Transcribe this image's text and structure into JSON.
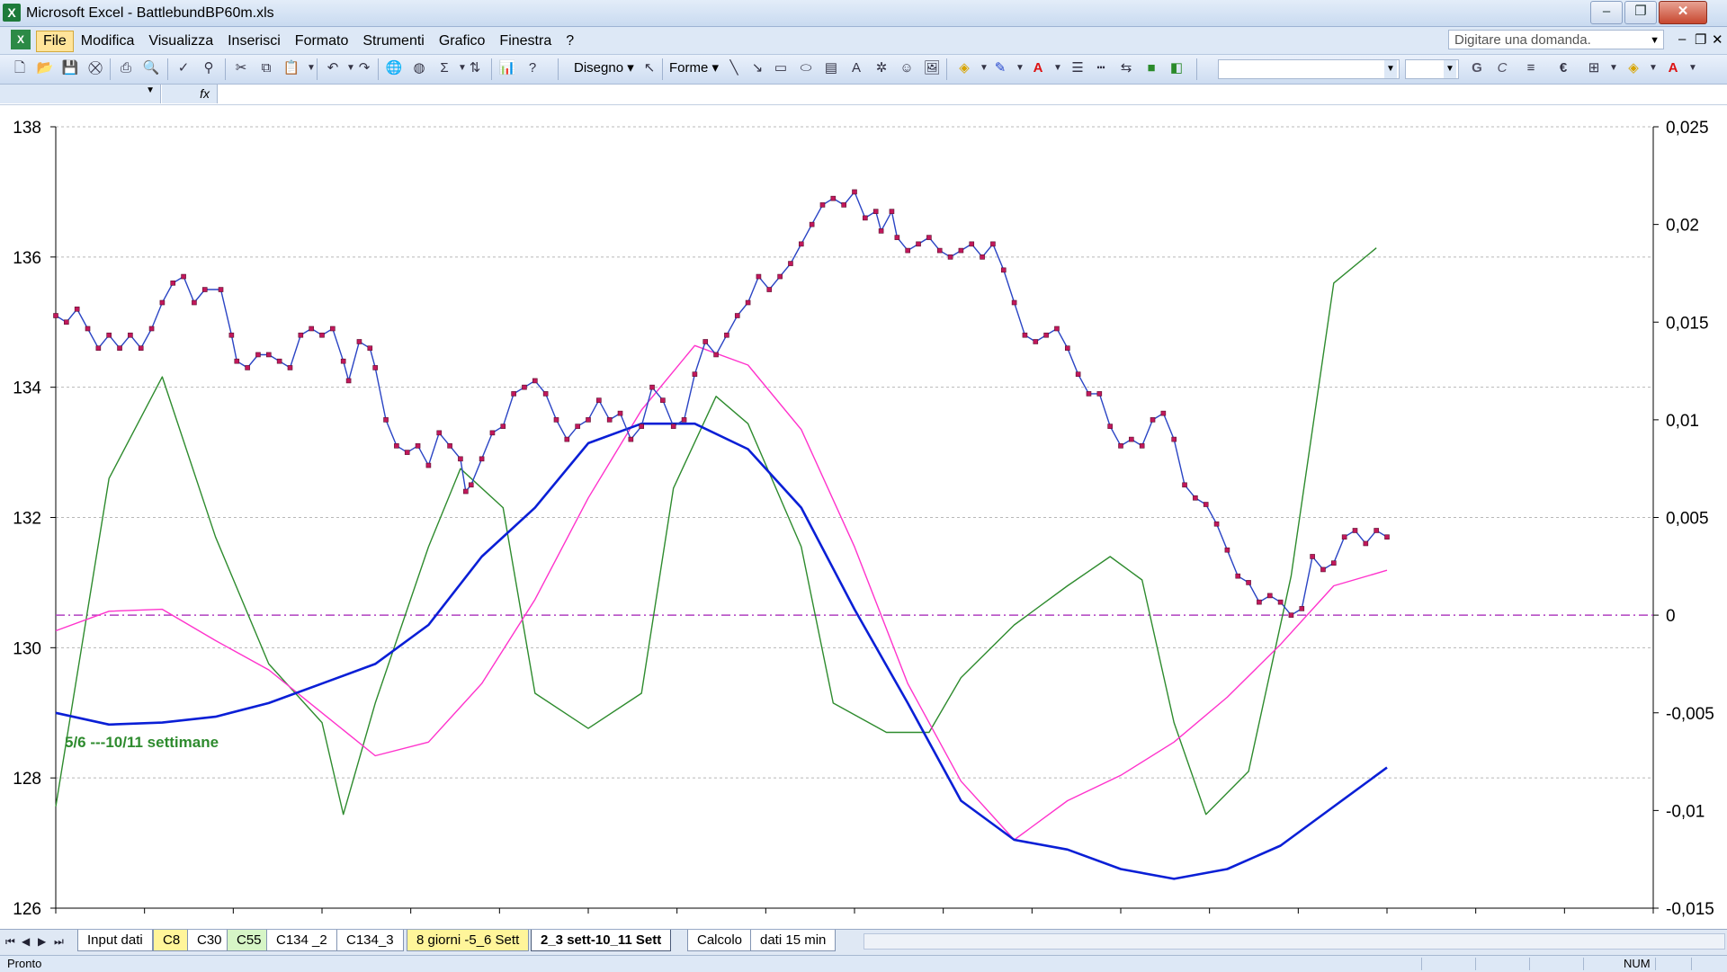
{
  "window": {
    "title": "Microsoft Excel - BattlebundBP60m.xls",
    "app_icon": "X"
  },
  "menu": {
    "doc_icon": "X",
    "items": [
      "File",
      "Modifica",
      "Visualizza",
      "Inserisci",
      "Formato",
      "Strumenti",
      "Grafico",
      "Finestra",
      "?"
    ],
    "active": "File",
    "ask_placeholder": "Digitare una domanda."
  },
  "toolbar": {
    "draw_label": "Disegno",
    "shapes_label": "Forme",
    "bold": "G",
    "italic": "C",
    "euro": "€"
  },
  "formula": {
    "fx": "fx"
  },
  "chart_data": {
    "type": "line",
    "title": "",
    "annotation": "5/6 ---10/11 settimane",
    "y_left": {
      "min": 126,
      "max": 138,
      "ticks": [
        "138",
        "136",
        "134",
        "132",
        "130",
        "128",
        "126"
      ]
    },
    "y_right": {
      "min": -0.015,
      "max": 0.025,
      "ticks": [
        "0,025",
        "0,02",
        "0,015",
        "0,01",
        "0,005",
        "0",
        "-0,005",
        "-0,01",
        "-0,015"
      ]
    },
    "grid": "horizontal-dashed",
    "zero_line_right": 0,
    "colors": {
      "price": "#2a44c4",
      "marker": "#c2185b",
      "blue": "#0a1fd6",
      "magenta": "#ff33cc",
      "green": "#2e8b2e",
      "zero": "#b040c0"
    },
    "series": [
      {
        "axis": "left",
        "style": "markers",
        "points": [
          [
            0,
            135.1
          ],
          [
            0.01,
            135.0
          ],
          [
            0.02,
            135.2
          ],
          [
            0.03,
            134.9
          ],
          [
            0.04,
            134.6
          ],
          [
            0.05,
            134.8
          ],
          [
            0.06,
            134.6
          ],
          [
            0.07,
            134.8
          ],
          [
            0.08,
            134.6
          ],
          [
            0.09,
            134.9
          ],
          [
            0.1,
            135.3
          ],
          [
            0.11,
            135.6
          ],
          [
            0.12,
            135.7
          ],
          [
            0.13,
            135.3
          ],
          [
            0.14,
            135.5
          ],
          [
            0.155,
            135.5
          ],
          [
            0.165,
            134.8
          ],
          [
            0.17,
            134.4
          ],
          [
            0.18,
            134.3
          ],
          [
            0.19,
            134.5
          ],
          [
            0.2,
            134.5
          ],
          [
            0.21,
            134.4
          ],
          [
            0.22,
            134.3
          ],
          [
            0.23,
            134.8
          ],
          [
            0.24,
            134.9
          ],
          [
            0.25,
            134.8
          ],
          [
            0.26,
            134.9
          ],
          [
            0.27,
            134.4
          ],
          [
            0.275,
            134.1
          ],
          [
            0.285,
            134.7
          ],
          [
            0.295,
            134.6
          ],
          [
            0.3,
            134.3
          ],
          [
            0.31,
            133.5
          ],
          [
            0.32,
            133.1
          ],
          [
            0.33,
            133.0
          ],
          [
            0.34,
            133.1
          ],
          [
            0.35,
            132.8
          ],
          [
            0.36,
            133.3
          ],
          [
            0.37,
            133.1
          ],
          [
            0.38,
            132.9
          ],
          [
            0.385,
            132.4
          ],
          [
            0.39,
            132.5
          ],
          [
            0.4,
            132.9
          ],
          [
            0.41,
            133.3
          ],
          [
            0.42,
            133.4
          ],
          [
            0.43,
            133.9
          ],
          [
            0.44,
            134.0
          ],
          [
            0.45,
            134.1
          ],
          [
            0.46,
            133.9
          ],
          [
            0.47,
            133.5
          ],
          [
            0.48,
            133.2
          ],
          [
            0.49,
            133.4
          ],
          [
            0.5,
            133.5
          ],
          [
            0.51,
            133.8
          ],
          [
            0.52,
            133.5
          ],
          [
            0.53,
            133.6
          ],
          [
            0.54,
            133.2
          ],
          [
            0.55,
            133.4
          ],
          [
            0.56,
            134.0
          ],
          [
            0.57,
            133.8
          ],
          [
            0.58,
            133.4
          ],
          [
            0.59,
            133.5
          ],
          [
            0.6,
            134.2
          ],
          [
            0.61,
            134.7
          ],
          [
            0.62,
            134.5
          ],
          [
            0.63,
            134.8
          ],
          [
            0.64,
            135.1
          ],
          [
            0.65,
            135.3
          ],
          [
            0.66,
            135.7
          ],
          [
            0.67,
            135.5
          ],
          [
            0.68,
            135.7
          ],
          [
            0.69,
            135.9
          ],
          [
            0.7,
            136.2
          ],
          [
            0.71,
            136.5
          ],
          [
            0.72,
            136.8
          ],
          [
            0.73,
            136.9
          ],
          [
            0.74,
            136.8
          ],
          [
            0.75,
            137.0
          ],
          [
            0.76,
            136.6
          ],
          [
            0.77,
            136.7
          ],
          [
            0.775,
            136.4
          ],
          [
            0.785,
            136.7
          ],
          [
            0.79,
            136.3
          ],
          [
            0.8,
            136.1
          ],
          [
            0.81,
            136.2
          ],
          [
            0.82,
            136.3
          ],
          [
            0.83,
            136.1
          ],
          [
            0.84,
            136.0
          ],
          [
            0.85,
            136.1
          ],
          [
            0.86,
            136.2
          ],
          [
            0.87,
            136.0
          ],
          [
            0.88,
            136.2
          ],
          [
            0.89,
            135.8
          ],
          [
            0.9,
            135.3
          ],
          [
            0.91,
            134.8
          ],
          [
            0.92,
            134.7
          ],
          [
            0.93,
            134.8
          ],
          [
            0.94,
            134.9
          ],
          [
            0.95,
            134.6
          ],
          [
            0.96,
            134.2
          ],
          [
            0.97,
            133.9
          ],
          [
            0.98,
            133.9
          ],
          [
            0.99,
            133.4
          ],
          [
            1.0,
            133.1
          ],
          [
            1.01,
            133.2
          ],
          [
            1.02,
            133.1
          ],
          [
            1.03,
            133.5
          ],
          [
            1.04,
            133.6
          ],
          [
            1.05,
            133.2
          ],
          [
            1.06,
            132.5
          ],
          [
            1.07,
            132.3
          ],
          [
            1.08,
            132.2
          ],
          [
            1.09,
            131.9
          ],
          [
            1.1,
            131.5
          ],
          [
            1.11,
            131.1
          ],
          [
            1.12,
            131.0
          ],
          [
            1.13,
            130.7
          ],
          [
            1.14,
            130.8
          ],
          [
            1.15,
            130.7
          ],
          [
            1.16,
            130.5
          ],
          [
            1.17,
            130.6
          ],
          [
            1.18,
            131.4
          ],
          [
            1.19,
            131.2
          ],
          [
            1.2,
            131.3
          ],
          [
            1.21,
            131.7
          ],
          [
            1.22,
            131.8
          ],
          [
            1.23,
            131.6
          ],
          [
            1.24,
            131.8
          ],
          [
            1.25,
            131.7
          ]
        ]
      },
      {
        "axis": "right",
        "style": "line",
        "color": "blue",
        "points": [
          [
            0,
            -0.005
          ],
          [
            0.05,
            -0.0056
          ],
          [
            0.1,
            -0.0055
          ],
          [
            0.15,
            -0.0052
          ],
          [
            0.2,
            -0.0045
          ],
          [
            0.25,
            -0.0035
          ],
          [
            0.3,
            -0.0025
          ],
          [
            0.35,
            -0.0005
          ],
          [
            0.4,
            0.003
          ],
          [
            0.45,
            0.0055
          ],
          [
            0.5,
            0.0088
          ],
          [
            0.55,
            0.0098
          ],
          [
            0.6,
            0.0098
          ],
          [
            0.65,
            0.0085
          ],
          [
            0.7,
            0.0055
          ],
          [
            0.75,
            0.0003
          ],
          [
            0.8,
            -0.0045
          ],
          [
            0.85,
            -0.0095
          ],
          [
            0.9,
            -0.0115
          ],
          [
            0.95,
            -0.012
          ],
          [
            1.0,
            -0.013
          ],
          [
            1.05,
            -0.0135
          ],
          [
            1.1,
            -0.013
          ],
          [
            1.15,
            -0.0118
          ],
          [
            1.2,
            -0.0098
          ],
          [
            1.25,
            -0.0078
          ]
        ]
      },
      {
        "axis": "right",
        "style": "line",
        "color": "magenta",
        "points": [
          [
            0,
            -0.0008
          ],
          [
            0.05,
            0.0002
          ],
          [
            0.1,
            0.0003
          ],
          [
            0.15,
            -0.0013
          ],
          [
            0.2,
            -0.0028
          ],
          [
            0.25,
            -0.005
          ],
          [
            0.3,
            -0.0072
          ],
          [
            0.35,
            -0.0065
          ],
          [
            0.4,
            -0.0035
          ],
          [
            0.45,
            0.0008
          ],
          [
            0.5,
            0.006
          ],
          [
            0.55,
            0.0105
          ],
          [
            0.6,
            0.0138
          ],
          [
            0.65,
            0.0128
          ],
          [
            0.7,
            0.0095
          ],
          [
            0.75,
            0.0035
          ],
          [
            0.8,
            -0.0035
          ],
          [
            0.85,
            -0.0085
          ],
          [
            0.9,
            -0.0115
          ],
          [
            0.95,
            -0.0095
          ],
          [
            1.0,
            -0.0082
          ],
          [
            1.05,
            -0.0065
          ],
          [
            1.1,
            -0.0042
          ],
          [
            1.15,
            -0.0015
          ],
          [
            1.2,
            0.0015
          ],
          [
            1.25,
            0.0023
          ]
        ]
      },
      {
        "axis": "right",
        "style": "line",
        "color": "green",
        "points": [
          [
            0,
            -0.0098
          ],
          [
            0.05,
            0.007
          ],
          [
            0.1,
            0.0122
          ],
          [
            0.15,
            0.004
          ],
          [
            0.2,
            -0.0025
          ],
          [
            0.25,
            -0.0055
          ],
          [
            0.27,
            -0.0102
          ],
          [
            0.3,
            -0.0045
          ],
          [
            0.35,
            0.0035
          ],
          [
            0.38,
            0.0075
          ],
          [
            0.42,
            0.0055
          ],
          [
            0.45,
            -0.004
          ],
          [
            0.5,
            -0.0058
          ],
          [
            0.55,
            -0.004
          ],
          [
            0.58,
            0.0065
          ],
          [
            0.62,
            0.0112
          ],
          [
            0.65,
            0.0098
          ],
          [
            0.7,
            0.0035
          ],
          [
            0.73,
            -0.0045
          ],
          [
            0.78,
            -0.006
          ],
          [
            0.82,
            -0.006
          ],
          [
            0.85,
            -0.0032
          ],
          [
            0.9,
            -0.0005
          ],
          [
            0.95,
            0.0015
          ],
          [
            0.99,
            0.003
          ],
          [
            1.02,
            0.0018
          ],
          [
            1.05,
            -0.0055
          ],
          [
            1.08,
            -0.0102
          ],
          [
            1.12,
            -0.008
          ],
          [
            1.16,
            0.002
          ],
          [
            1.2,
            0.017
          ],
          [
            1.24,
            0.0188
          ]
        ]
      }
    ]
  }
}
